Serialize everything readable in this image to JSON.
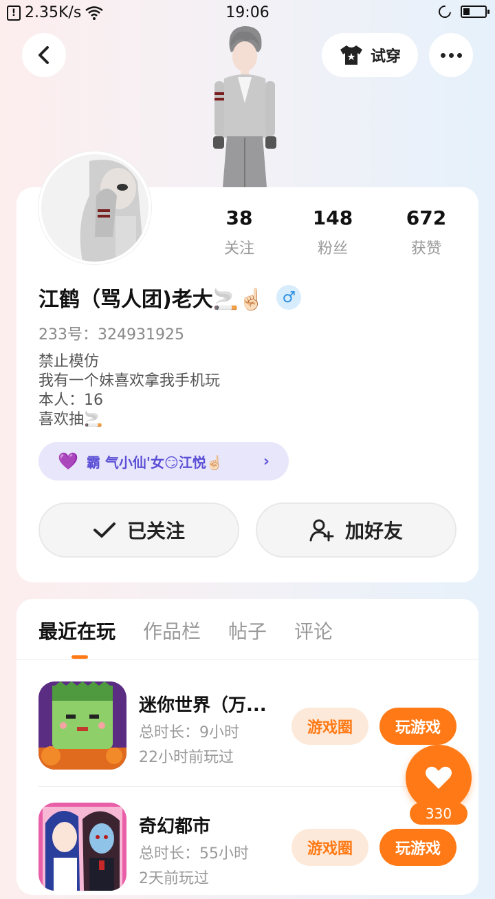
{
  "status_bar": {
    "speed": "2.35K/s",
    "time": "19:06",
    "battery_level": 0.3
  },
  "header": {
    "try_on_label": "试穿"
  },
  "stats": [
    {
      "num": "38",
      "label": "关注"
    },
    {
      "num": "148",
      "label": "粉丝"
    },
    {
      "num": "672",
      "label": "获赞"
    }
  ],
  "profile": {
    "nickname": "江鹤（骂人团)老大🚬☝🏻",
    "gender_symbol": "♂",
    "uid": "233号：324931925",
    "bio": "禁止模仿\n 我有一个妹喜欢拿我手机玩\n本人：16\n喜欢抽🚬",
    "cp_label": "霸 气小仙'女😏江悦☝🏻"
  },
  "actions": {
    "follow_label": "已关注",
    "add_friend_label": "加好友"
  },
  "tabs": [
    "最近在玩",
    "作品栏",
    "帖子",
    "评论"
  ],
  "games": [
    {
      "name": "迷你世界（万...",
      "duration": "总时长：9小时",
      "last_played": "22小时前玩过",
      "circle_label": "游戏圈",
      "play_label": "玩游戏"
    },
    {
      "name": "奇幻都市",
      "duration": "总时长：55小时",
      "last_played": "2天前玩过",
      "circle_label": "游戏圈",
      "play_label": "玩游戏"
    }
  ],
  "like": {
    "count": "330"
  },
  "colors": {
    "accent": "#ff7a16",
    "cp_purple": "#5b4fd6",
    "gender_blue": "#2b8fe3"
  }
}
